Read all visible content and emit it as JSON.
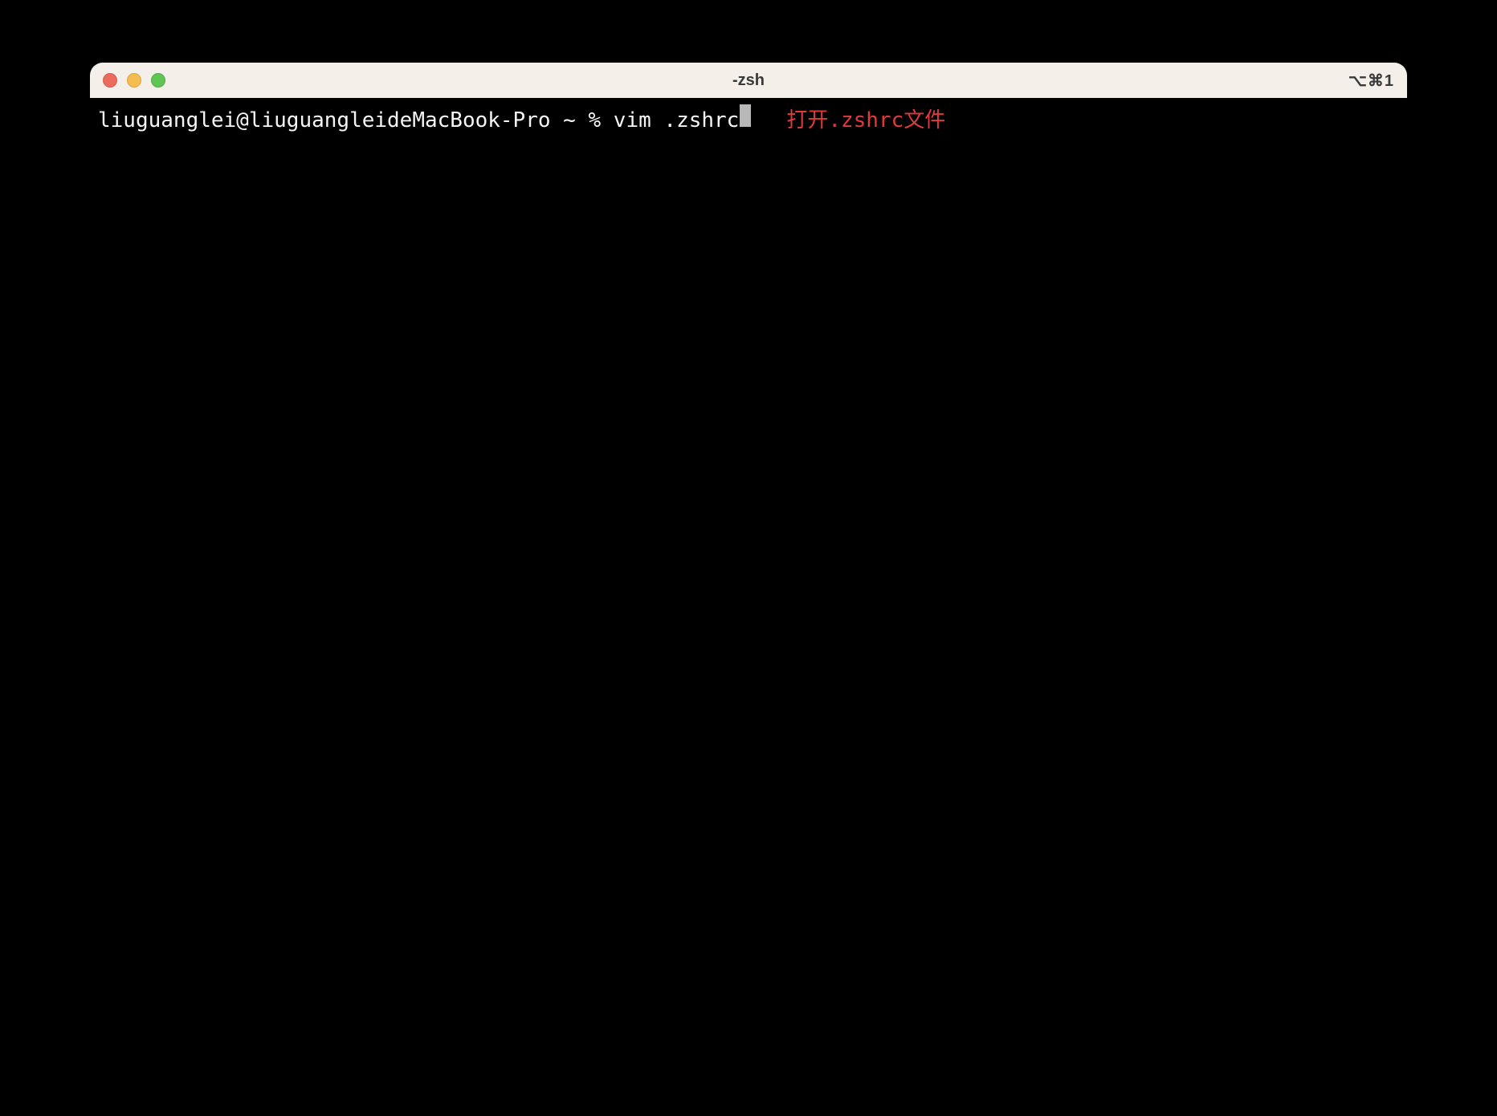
{
  "window": {
    "title": "-zsh",
    "shortcut_indicator": "⌥⌘1"
  },
  "terminal": {
    "prompt": "liuguanglei@liuguangleideMacBook-Pro ~ % ",
    "command": "vim .zshrc",
    "annotation": "打开.zshrc文件"
  }
}
